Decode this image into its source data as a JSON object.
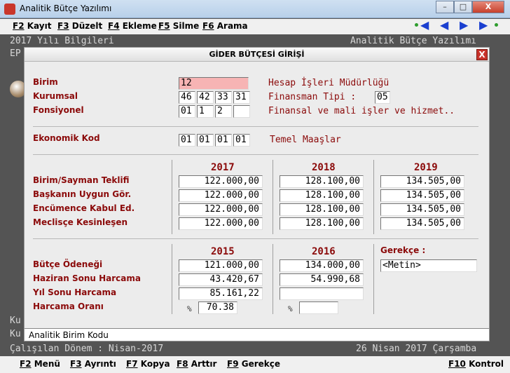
{
  "window": {
    "title": "Analitik Bütçe Yazılımı",
    "min": "–",
    "max": "□",
    "close": "X"
  },
  "menubar": [
    {
      "key": "F2",
      "label": "Kayıt"
    },
    {
      "key": "F3",
      "label": "Düzelt"
    },
    {
      "key": "F4",
      "label": "Ekleme"
    },
    {
      "key": "F5",
      "label": "Silme"
    },
    {
      "key": "F6",
      "label": "Arama"
    }
  ],
  "background": {
    "left_title": "2017 Yılı Bilgileri",
    "right_title": "Analitik Bütçe Yazılımı",
    "ep": "EP",
    "ku1": "Ku",
    "ku2": "Ku"
  },
  "status": {
    "period": "Çalışılan Dönem : Nisan-2017",
    "date": "26 Nisan 2017 Çarşamba"
  },
  "bottombar": [
    {
      "key": "F2",
      "label": "Menü"
    },
    {
      "key": "F3",
      "label": "Ayrıntı"
    },
    {
      "key": "F7",
      "label": "Kopya"
    },
    {
      "key": "F8",
      "label": "Arttır"
    },
    {
      "key": "F9",
      "label": "Gerekçe"
    },
    {
      "key": "F10",
      "label": "Kontrol"
    }
  ],
  "dialog": {
    "title": "GİDER BÜTÇESİ GİRİŞİ",
    "close": "X",
    "birim": {
      "label": "Birim",
      "value": "12",
      "desc": "Hesap İşleri Müdürlüğü"
    },
    "kurumsal": {
      "label": "Kurumsal",
      "parts": [
        "46",
        "42",
        "33",
        "31"
      ],
      "desc": "Finansman Tipi :",
      "finansman": "05"
    },
    "fonsiyonel": {
      "label": "Fonsiyonel",
      "parts": [
        "01",
        "1",
        "2",
        ""
      ],
      "desc": "Finansal ve mali işler ve hizmet.."
    },
    "ekonomik": {
      "label": "Ekonomik Kod",
      "parts": [
        "01",
        "01",
        "01",
        "01"
      ],
      "desc": "Temel Maaşlar"
    },
    "years": [
      "2017",
      "2018",
      "2019"
    ],
    "rows": [
      {
        "label": "Birim/Sayman Teklifi",
        "values": [
          "122.000,00",
          "128.100,00",
          "134.505,00"
        ]
      },
      {
        "label": "Başkanın Uygun Gör.",
        "values": [
          "122.000,00",
          "128.100,00",
          "134.505,00"
        ]
      },
      {
        "label": "Encümence Kabul Ed.",
        "values": [
          "122.000,00",
          "128.100,00",
          "134.505,00"
        ]
      },
      {
        "label": "Meclisçe Kesinleşen",
        "values": [
          "122.000,00",
          "128.100,00",
          "134.505,00"
        ]
      }
    ],
    "past_years": [
      "2015",
      "2016"
    ],
    "gerekce_label": "Gerekçe :",
    "gerekce_value": "<Metin>",
    "past_rows": [
      {
        "label": "Bütçe Ödeneği",
        "values": [
          "121.000,00",
          "134.000,00"
        ]
      },
      {
        "label": "Haziran Sonu Harcama",
        "values": [
          "43.420,67",
          "54.990,68"
        ]
      },
      {
        "label": "Yıl Sonu Harcama",
        "values": [
          "85.161,22",
          ""
        ]
      },
      {
        "label": "Harcama Oranı",
        "values": [
          "70.38",
          ""
        ]
      }
    ],
    "pct_symbol": "%",
    "status_text": "Analitik Birim Kodu"
  }
}
